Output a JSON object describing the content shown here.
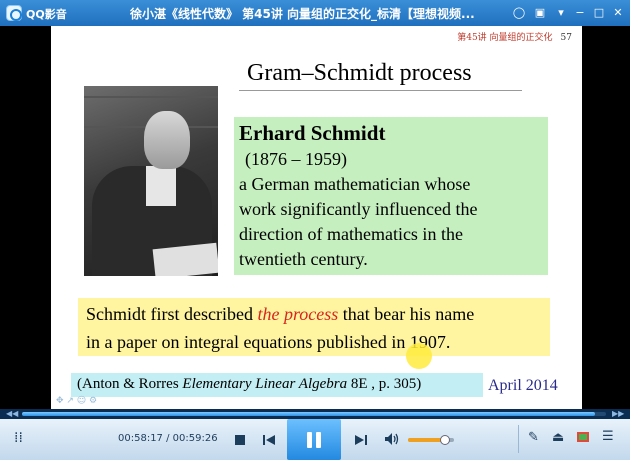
{
  "window": {
    "app_name": "QQ影音",
    "title": "徐小湛《线性代数》 第45讲 向量组的正交化_标清【理想视频..."
  },
  "slide": {
    "header_text": "第45讲  向量组的正交化",
    "page_number": "57",
    "title": "Gram–Schmidt process",
    "bio": {
      "name": "Erhard Schmidt",
      "years": "(1876 – 1959)",
      "lines": [
        "a German mathematician whose",
        "work significantly influenced the",
        "direction of mathematics in the",
        "twentieth century."
      ]
    },
    "process": {
      "line1_pre": "Schmidt first described ",
      "line1_em": "the process",
      "line1_post": " that bear his name",
      "line2": "in a paper on integral equations published in 1907."
    },
    "citation": {
      "pre": "(Anton & Rorres ",
      "book": "Elementary Linear Algebra",
      "post": " 8E , p. 305)"
    },
    "date": "April 2014"
  },
  "player": {
    "time_display": "00:58:17 / 00:59:26",
    "progress_fraction": 0.9807,
    "volume_fraction": 0.8,
    "accent_color": "#2389e0",
    "volume_color": "#f0a020"
  },
  "icons": {
    "title_buttons": [
      "chat-icon",
      "skin-icon",
      "menu-icon",
      "minimize-icon",
      "maximize-icon",
      "close-icon"
    ],
    "controls_left": [
      "footprints-icon"
    ],
    "controls_center": [
      "stop-icon",
      "previous-icon",
      "pause-icon",
      "next-icon",
      "volume-icon"
    ],
    "controls_right": [
      "toolbox-icon",
      "eject-icon",
      "screenshot-icon",
      "playlist-icon"
    ]
  }
}
